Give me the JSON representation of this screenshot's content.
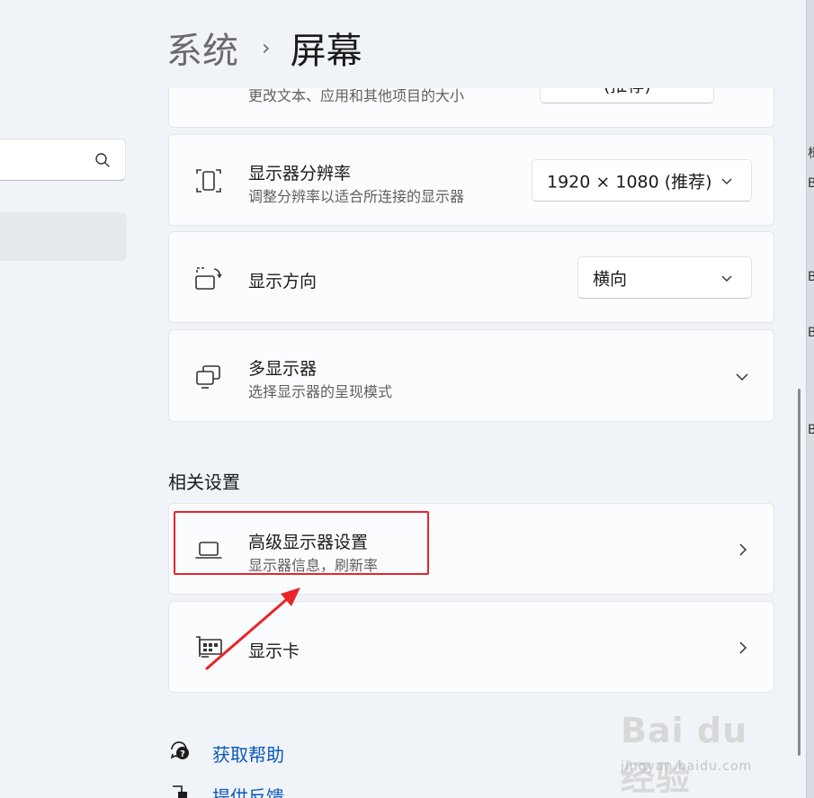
{
  "header": {
    "breadcrumb_parent": "系统",
    "breadcrumb_sep": "›",
    "page_title": "屏幕"
  },
  "side_strip_chars": [
    "楫",
    "B",
    "B",
    "B",
    "B"
  ],
  "scale_row": {
    "subtitle": "更改文本、应用和其他项目的大小",
    "dropdown_value": "(推荐)"
  },
  "resolution": {
    "title": "显示器分辨率",
    "subtitle": "调整分辨率以适合所连接的显示器",
    "dropdown_value": "1920 × 1080 (推荐)"
  },
  "orientation": {
    "title": "显示方向",
    "dropdown_value": "横向"
  },
  "multi_display": {
    "title": "多显示器",
    "subtitle": "选择显示器的呈现模式"
  },
  "related_settings": {
    "heading": "相关设置",
    "advanced_display": {
      "title": "高级显示器设置",
      "subtitle": "显示器信息，刷新率"
    },
    "graphics": {
      "title": "显示卡"
    }
  },
  "links": {
    "get_help": "获取帮助",
    "feedback": "提供反馈"
  },
  "watermark": {
    "brand": "Bai du 经验",
    "url": "jingyan.baidu.com"
  },
  "icons": {
    "search": "search-icon",
    "scale": "scale-icon",
    "resolution": "resolution-icon",
    "orientation": "orientation-icon",
    "multi_display": "multi-display-icon",
    "advanced_display": "laptop-icon",
    "graphics": "graphics-card-icon",
    "help": "help-icon",
    "feedback": "feedback-icon",
    "chevron_right": "chevron-right-icon",
    "chevron_down": "chevron-down-icon"
  },
  "colors": {
    "annotation": "#e8252b",
    "link": "#0b58b8",
    "background": "#f0f4f9"
  }
}
